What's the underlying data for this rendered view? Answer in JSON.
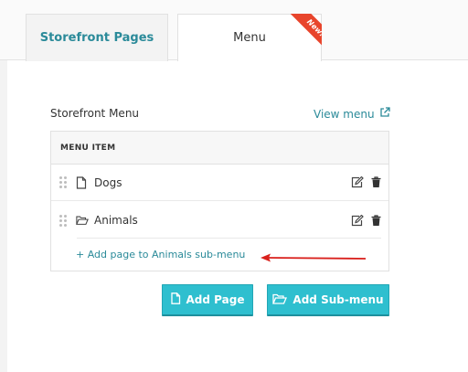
{
  "tabs": [
    {
      "label": "Storefront Pages"
    },
    {
      "label": "Menu",
      "badge": "New!"
    }
  ],
  "menu": {
    "title": "Storefront Menu",
    "view_menu_label": "View menu",
    "column_header": "MENU ITEM",
    "items": [
      {
        "label": "Dogs",
        "icon": "page-icon"
      },
      {
        "label": "Animals",
        "icon": "folder-open-icon"
      }
    ],
    "add_submenu_link": "+ Add page to Animals sub-menu"
  },
  "buttons": {
    "add_page": "Add Page",
    "add_submenu": "Add Sub-menu"
  },
  "colors": {
    "accent": "#2ebfcf",
    "link": "#2a8a99",
    "badge": "#e8452c",
    "annotation_arrow": "#d9201c"
  }
}
